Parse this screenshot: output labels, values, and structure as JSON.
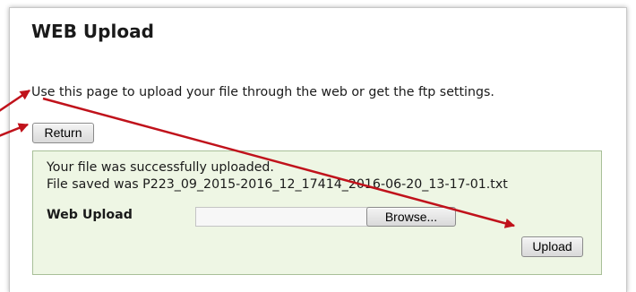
{
  "page": {
    "title": "WEB Upload",
    "intro": "Use this page to upload your file through the web or get the ftp settings.",
    "return_label": "Return"
  },
  "upload_box": {
    "success_message": "Your file was successfully uploaded.",
    "saved_message": "File saved was P223_09_2015-2016_12_17414_2016-06-20_13-17-01.txt",
    "field_label": "Web Upload",
    "file_value": "",
    "browse_label": "Browse...",
    "upload_label": "Upload"
  },
  "colors": {
    "box_background": "#eef6e4",
    "box_border": "#a8bf98",
    "annotation_arrow": "#c0121b"
  }
}
